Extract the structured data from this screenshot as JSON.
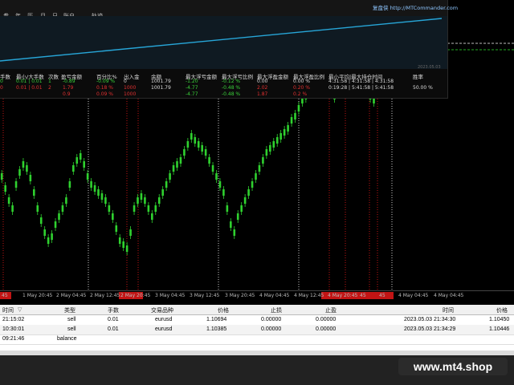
{
  "panel": {
    "tabs": [
      "参",
      "年",
      "历",
      "月",
      "日",
      "账户",
      "轨迹"
    ],
    "link": "复盘侠 http://MTCommander.com",
    "mini_date": "2023.05.03",
    "headers": [
      "手数",
      "最小/大手数",
      "次数",
      "盈亏金额",
      "百分比%",
      "出入金",
      "余额",
      "最大浮亏金额",
      "最大浮亏比例",
      "最大浮盈金额",
      "最大浮盈比例",
      "最小平均|最大持仓时间",
      "胜率"
    ],
    "rows": [
      {
        "lots": "0",
        "minmax": "0.01 | 0.01",
        "count": "1",
        "pnl": "-0.89",
        "pct": "-0.09 %",
        "flow": "0",
        "balance": "1001.79",
        "maxloss": "-1.20",
        "maxlosspct": "-0.12 %",
        "maxgain": "0.00",
        "maxgainpct": "0.00 %",
        "hold": "4:31:58 | 4:31:58 | 4:31:58",
        "winrate": ""
      },
      {
        "lots": "0",
        "minmax": "0.01 | 0.01",
        "count": "2",
        "pnl": "1.79",
        "pct": "0.18 %",
        "flow": "1000",
        "balance": "1001.79",
        "maxloss": "-4.77",
        "maxlosspct": "-0.48 %",
        "maxgain": "2.02",
        "maxgainpct": "0.20 %",
        "hold": "0:19:28 | 5:41:58 | 5:41:58",
        "winrate": "50.00 %"
      },
      {
        "lots": "",
        "minmax": "",
        "count": "",
        "pnl": "0.9",
        "pct": "0.09 %",
        "flow": "1000",
        "balance": "",
        "maxloss": "-4.77",
        "maxlosspct": "-0.48 %",
        "maxgain": "1.87",
        "maxgainpct": "0.2 %",
        "hold": "",
        "winrate": ""
      }
    ]
  },
  "axis": {
    "labels": [
      "45",
      "1 May 20:45",
      "2 May 04:45",
      "2 May 12:45",
      "2 May 20:45",
      "3 May 04:45",
      "3 May 12:45",
      "3 May 20:45",
      "4 May 04:45",
      "4 May 12:45",
      "4 May 20:45",
      "45",
      "45",
      "4 May 04:45",
      "4 May 04:45"
    ]
  },
  "terminal": {
    "headers": {
      "time": "时间",
      "sort": "▽",
      "type": "类型",
      "lots": "手数",
      "symbol": "交易品种",
      "price": "价格",
      "sl": "止损",
      "tp": "止盈",
      "close_time": "时间",
      "close_price": "价格"
    },
    "rows": [
      {
        "time": "21:15:02",
        "type": "sell",
        "lots": "0.01",
        "symbol": "eurusd",
        "price": "1.10694",
        "sl": "0.00000",
        "tp": "0.00000",
        "close_time": "2023.05.03 21:34:30",
        "close_price": "1.10450"
      },
      {
        "time": "10:30:01",
        "type": "sell",
        "lots": "0.01",
        "symbol": "eurusd",
        "price": "1.10385",
        "sl": "0.00000",
        "tp": "0.00000",
        "close_time": "2023.05.03 21:34:29",
        "close_price": "1.10446"
      },
      {
        "time": "09:21:46",
        "type": "balance",
        "lots": "",
        "symbol": "",
        "price": "",
        "sl": "",
        "tp": "",
        "close_time": "",
        "close_price": ""
      }
    ]
  },
  "watermark": "www.mt4.shop",
  "colors": {
    "bull": "#2fd12f",
    "equity": "#27a6d8",
    "grid_red": "#c21414",
    "grid_white": "#cccccc"
  },
  "chart_data": {
    "type": "candlestick",
    "series": [
      {
        "values": [
          260,
          275,
          290,
          300,
          270,
          255,
          245,
          250,
          262,
          280,
          300,
          315,
          330,
          340,
          335,
          320,
          310,
          300,
          290,
          270,
          250,
          240,
          235,
          245,
          260,
          270,
          275,
          280,
          285,
          290,
          300,
          310,
          325,
          340,
          345,
          350,
          330,
          300,
          290,
          285,
          290,
          300,
          310,
          300,
          290,
          280,
          270,
          260,
          250,
          245,
          240,
          230,
          220,
          210,
          215,
          220,
          225,
          230,
          240,
          250,
          260,
          270,
          280,
          300,
          320,
          330,
          310,
          300,
          290,
          280,
          270,
          260,
          250,
          240,
          230,
          225,
          220,
          215,
          210,
          205,
          200,
          190,
          185,
          175,
          165,
          160,
          155,
          150,
          145,
          140,
          145,
          150,
          155,
          160,
          150,
          140,
          135,
          130,
          125,
          130,
          135,
          140,
          150,
          160,
          165,
          155,
          145,
          140,
          135,
          125
        ]
      }
    ]
  }
}
